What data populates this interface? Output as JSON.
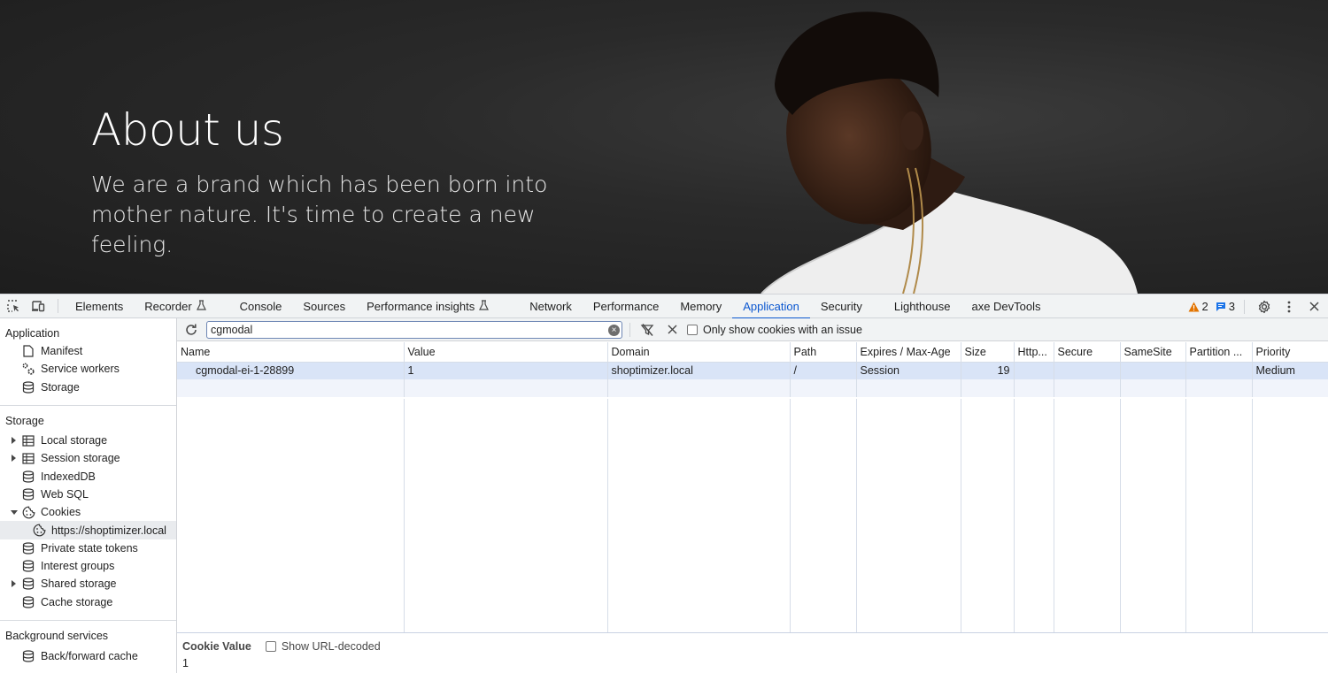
{
  "hero": {
    "title": "About us",
    "subtitle": "We are a brand which has been born into mother nature. It's time to create a new feeling."
  },
  "devtools": {
    "tabs": [
      {
        "label": "Elements"
      },
      {
        "label": "Recorder",
        "experimental": true
      },
      {
        "label": "Console"
      },
      {
        "label": "Sources"
      },
      {
        "label": "Performance insights",
        "experimental": true
      },
      {
        "label": "Network"
      },
      {
        "label": "Performance"
      },
      {
        "label": "Memory"
      },
      {
        "label": "Application",
        "active": true
      },
      {
        "label": "Security"
      },
      {
        "label": "Lighthouse"
      },
      {
        "label": "axe DevTools"
      }
    ],
    "warnings_count": "2",
    "messages_count": "3",
    "colors": {
      "accent": "#0b57d0",
      "warning": "#e37400",
      "message": "#1a73e8",
      "selected_row": "#d9e4f7"
    }
  },
  "sidebar": {
    "application": {
      "heading": "Application",
      "items": [
        {
          "label": "Manifest",
          "icon": "document-icon"
        },
        {
          "label": "Service workers",
          "icon": "gears-icon"
        },
        {
          "label": "Storage",
          "icon": "database-icon"
        }
      ]
    },
    "storage": {
      "heading": "Storage",
      "items": [
        {
          "label": "Local storage",
          "icon": "table-icon",
          "expandable": "collapsed"
        },
        {
          "label": "Session storage",
          "icon": "table-icon",
          "expandable": "collapsed"
        },
        {
          "label": "IndexedDB",
          "icon": "database-icon"
        },
        {
          "label": "Web SQL",
          "icon": "database-icon"
        },
        {
          "label": "Cookies",
          "icon": "cookie-icon",
          "expandable": "expanded"
        },
        {
          "label": "https://shoptimizer.local",
          "icon": "cookie-icon",
          "selected": true
        },
        {
          "label": "Private state tokens",
          "icon": "database-icon"
        },
        {
          "label": "Interest groups",
          "icon": "database-icon"
        },
        {
          "label": "Shared storage",
          "icon": "database-icon",
          "expandable": "collapsed"
        },
        {
          "label": "Cache storage",
          "icon": "database-icon"
        }
      ]
    },
    "background": {
      "heading": "Background services",
      "items": [
        {
          "label": "Back/forward cache",
          "icon": "database-icon"
        }
      ]
    }
  },
  "cookies": {
    "filter_value": "cgmodal",
    "only_issues_label": "Only show cookies with an issue",
    "columns": [
      "Name",
      "Value",
      "Domain",
      "Path",
      "Expires / Max-Age",
      "Size",
      "Http...",
      "Secure",
      "SameSite",
      "Partition ...",
      "Priority"
    ],
    "rows": [
      [
        "cgmodal-ei-1-28899",
        "1",
        "shoptimizer.local",
        "/",
        "Session",
        "19",
        "",
        "",
        "",
        "",
        "Medium"
      ]
    ],
    "cookie_value_label": "Cookie Value",
    "show_decoded_label": "Show URL-decoded",
    "cookie_value": "1"
  }
}
